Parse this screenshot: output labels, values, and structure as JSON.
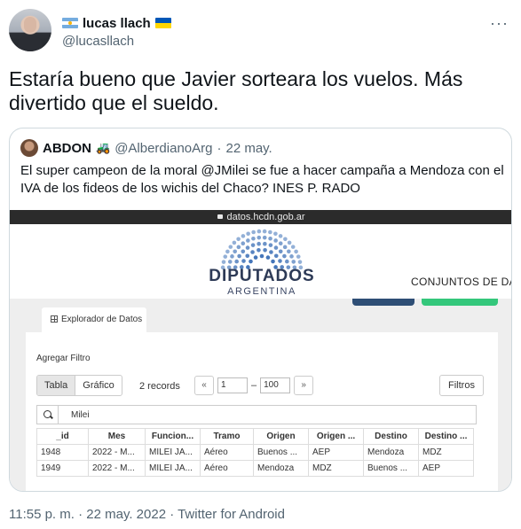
{
  "author": {
    "display_name": "lucas llach",
    "handle": "@lucasllach"
  },
  "more_label": "···",
  "tweet_text": "Estaría bueno que Javier sorteara los vuelos. Más divertido que el sueldo.",
  "quoted": {
    "name": "ABDON",
    "emoji": "🚜",
    "handle": "@AlberdianoArg",
    "dot": "·",
    "date": "22 may.",
    "text": "El super campeon de la moral @JMilei se fue a hacer campaña a Mendoza con el IVA de los fideos de los wichis del Chaco? INES P. RADO"
  },
  "screenshot": {
    "url": "datos.hcdn.gob.ar",
    "logo_title": "DIPUTADOS",
    "logo_subtitle": "ARGENTINA",
    "nav_item": "CONJUNTOS DE DATO",
    "tab_label": "Explorador de Datos",
    "add_filter": "Agregar Filtro",
    "view_table": "Tabla",
    "view_chart": "Gráfico",
    "records": "2 records",
    "pager_prev": "«",
    "pager_from": "1",
    "pager_dash": "–",
    "pager_to": "100",
    "pager_next": "»",
    "filters_button": "Filtros",
    "search_value": "Milei",
    "columns": [
      "_id",
      "Mes",
      "Funcion...",
      "Tramo",
      "Origen",
      "Origen ...",
      "Destino",
      "Destino ..."
    ],
    "rows": [
      [
        "1948",
        "2022 - M...",
        "MILEI JA...",
        "Aéreo",
        "Buenos ...",
        "AEP",
        "Mendoza",
        "MDZ"
      ],
      [
        "1949",
        "2022 - M...",
        "MILEI JA...",
        "Aéreo",
        "Mendoza",
        "MDZ",
        "Buenos ...",
        "AEP"
      ]
    ]
  },
  "footer": "11:55 p. m. · 22 may. 2022 · Twitter for Android",
  "colors": {
    "text_primary": "#0f1419",
    "text_secondary": "#536471",
    "border": "#cfd9de",
    "logo_blue": "#3b6fb6",
    "green_button": "#34c77b"
  }
}
